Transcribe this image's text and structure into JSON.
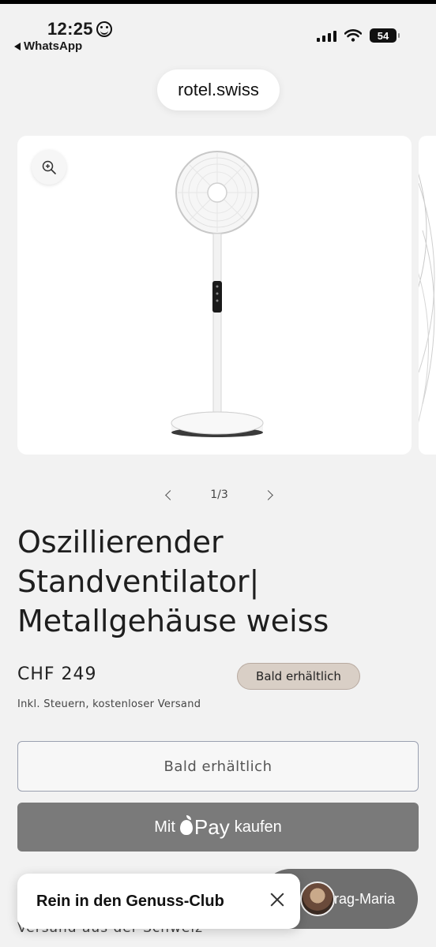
{
  "status_bar": {
    "time": "12:25",
    "back_app": "WhatsApp",
    "battery": "54"
  },
  "browser": {
    "url": "rotel.swiss"
  },
  "gallery": {
    "pager_text": "1/3",
    "zoom_icon": "zoom-in-icon",
    "prev_icon": "chevron-left-icon",
    "next_icon": "chevron-right-icon"
  },
  "product": {
    "title_line1": "Oszillierender",
    "title_line2": "Standventilator|",
    "title_line3": "Metallgehäuse weiss",
    "price": "CHF 249",
    "badge": "Bald erhältlich",
    "tax_note": "Inkl. Steuern, kostenloser Versand"
  },
  "actions": {
    "soon_label": "Bald erhältlich",
    "applepay_prefix": "Mit",
    "applepay_pay": "Pay",
    "applepay_suffix": "kaufen"
  },
  "footer": {
    "shipping_text": "Versand aus der Schweiz"
  },
  "popup": {
    "club_text": "Rein in den Genuss-Club"
  },
  "chat": {
    "label": "Frag-Maria"
  },
  "colors": {
    "background": "#f2f2f2",
    "badge_bg": "#d9cfc6",
    "applepay_bg": "#7a7a7a",
    "chat_bg": "#6f6f6f"
  }
}
